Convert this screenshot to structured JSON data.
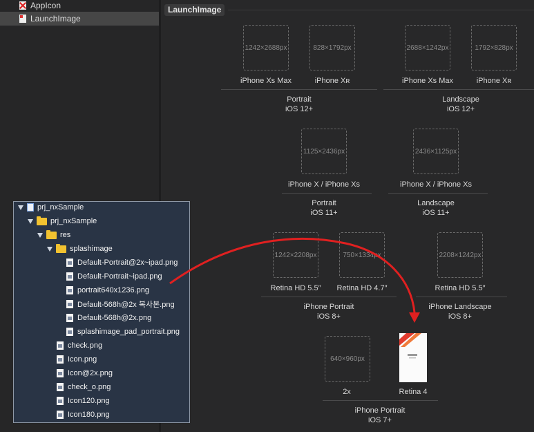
{
  "sidebar": {
    "items": [
      {
        "label": "AppIcon",
        "icon": "appicon-icon",
        "selected": false
      },
      {
        "label": "LaunchImage",
        "icon": "launchimage-icon",
        "selected": true
      }
    ]
  },
  "asset_set": {
    "title": "LaunchImage",
    "slots": [
      {
        "size": "1242×2688px",
        "label": "iPhone Xs Max"
      },
      {
        "size": "828×1792px",
        "label": "iPhone Xʀ"
      },
      {
        "size": "2688×1242px",
        "label": "iPhone Xs Max"
      },
      {
        "size": "1792×828px",
        "label": "iPhone Xʀ"
      },
      {
        "size": "1125×2436px",
        "label": "iPhone X / iPhone Xs"
      },
      {
        "size": "2436×1125px",
        "label": "iPhone X / iPhone Xs"
      },
      {
        "size": "1242×2208px",
        "label": "Retina HD 5.5″"
      },
      {
        "size": "750×1334px",
        "label": "Retina HD 4.7″"
      },
      {
        "size": "2208×1242px",
        "label": "Retina HD 5.5″"
      },
      {
        "size": "640×960px",
        "label": "2x"
      },
      {
        "size": "",
        "label": "Retina 4"
      }
    ],
    "groups": [
      {
        "line1": "Portrait",
        "line2": "iOS 12+"
      },
      {
        "line1": "Landscape",
        "line2": "iOS 12+"
      },
      {
        "line1": "Portrait",
        "line2": "iOS 11+"
      },
      {
        "line1": "Landscape",
        "line2": "iOS 11+"
      },
      {
        "line1": "iPhone Portrait",
        "line2": "iOS 8+"
      },
      {
        "line1": "iPhone Landscape",
        "line2": "iOS 8+"
      },
      {
        "line1": "iPhone Portrait",
        "line2": "iOS 7+"
      }
    ]
  },
  "file_tree": {
    "items": [
      {
        "label": "prj_nxSample",
        "kind": "project"
      },
      {
        "label": "prj_nxSample",
        "kind": "folder"
      },
      {
        "label": "res",
        "kind": "folder"
      },
      {
        "label": "splashimage",
        "kind": "folder"
      },
      {
        "label": "Default-Portrait@2x~ipad.png",
        "kind": "file"
      },
      {
        "label": "Default-Portrait~ipad.png",
        "kind": "file"
      },
      {
        "label": "portrait640x1236.png",
        "kind": "file"
      },
      {
        "label": "Default-568h@2x 복사본.png",
        "kind": "file"
      },
      {
        "label": "Default-568h@2x.png",
        "kind": "file"
      },
      {
        "label": "splashimage_pad_portrait.png",
        "kind": "file"
      },
      {
        "label": "check.png",
        "kind": "file"
      },
      {
        "label": "Icon.png",
        "kind": "file"
      },
      {
        "label": "Icon@2x.png",
        "kind": "file"
      },
      {
        "label": "check_o.png",
        "kind": "file"
      },
      {
        "label": "Icon120.png",
        "kind": "file"
      },
      {
        "label": "Icon180.png",
        "kind": "file"
      }
    ]
  },
  "colors": {
    "arrow": "#e02020",
    "tree_bg": "#293445",
    "folder": "#f2c230"
  }
}
